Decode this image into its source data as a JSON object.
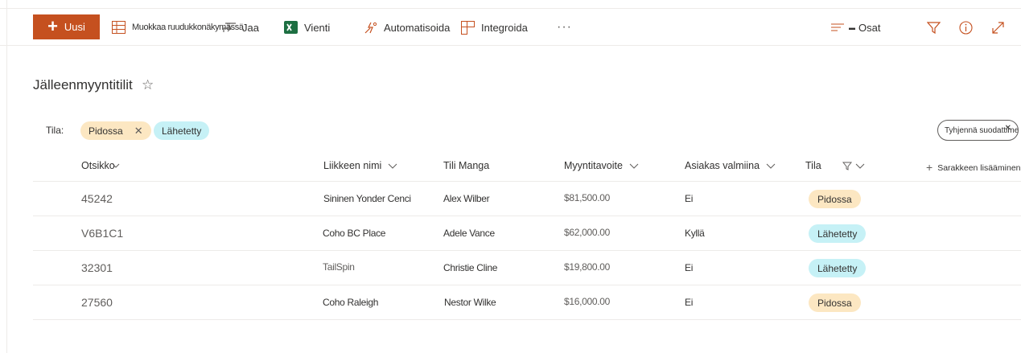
{
  "commandbar": {
    "new_label": "Uusi",
    "edit_grid_label": "Muokkaa ruudukkonäkymässä",
    "share_label": "Jaa",
    "export_label": "Vienti",
    "automate_label": "Automatisoida",
    "integrate_label": "Integroida",
    "more_label": "···",
    "parts_label": "Osat",
    "colors": {
      "new_bg": "#c5501f",
      "excel": "#1d6f42",
      "accent": "#c5501f"
    }
  },
  "list": {
    "title": "Jälleenmyyntitilit",
    "favorite_icon": "☆"
  },
  "filters": {
    "label": "Tila:",
    "pills": [
      {
        "label": "Pidossa",
        "remove": "✕"
      },
      {
        "label": "Lähetetty"
      }
    ],
    "clear_label": "Tyhjennä suodattimet",
    "clear_x": "✕"
  },
  "table": {
    "columns": {
      "title": "Otsikko",
      "business": "Liikkeen nimi",
      "manager": "Tili Manga",
      "target": "Myyntitavoite",
      "ready": "Asiakas valmiina",
      "status": "Tila"
    },
    "add_column": "Sarakkeen lisääminen",
    "add_plus": "+",
    "rows": [
      {
        "title": "45242",
        "business": "Sininen Yonder Cenci",
        "manager": "Alex Wilber",
        "target": "$81,500.00",
        "ready": "Ei",
        "status": "Pidossa",
        "status_color": "orange"
      },
      {
        "title": "V6B1C1",
        "business": "Coho BC Place",
        "manager": "Adele Vance",
        "target": "$62,000.00",
        "ready": "Kyllä",
        "status": "Lähetetty",
        "status_color": "cyan"
      },
      {
        "title": "32301",
        "business": "TailSpin",
        "manager": "Christie Cline",
        "target": "$19,800.00",
        "ready": "Ei",
        "status": "Lähetetty",
        "status_color": "cyan"
      },
      {
        "title": "27560",
        "business": "Coho Raleigh",
        "manager": "Nestor Wilke",
        "target": "$16,000.00",
        "ready": "Ei",
        "status": "Pidossa",
        "status_color": "orange"
      }
    ]
  }
}
